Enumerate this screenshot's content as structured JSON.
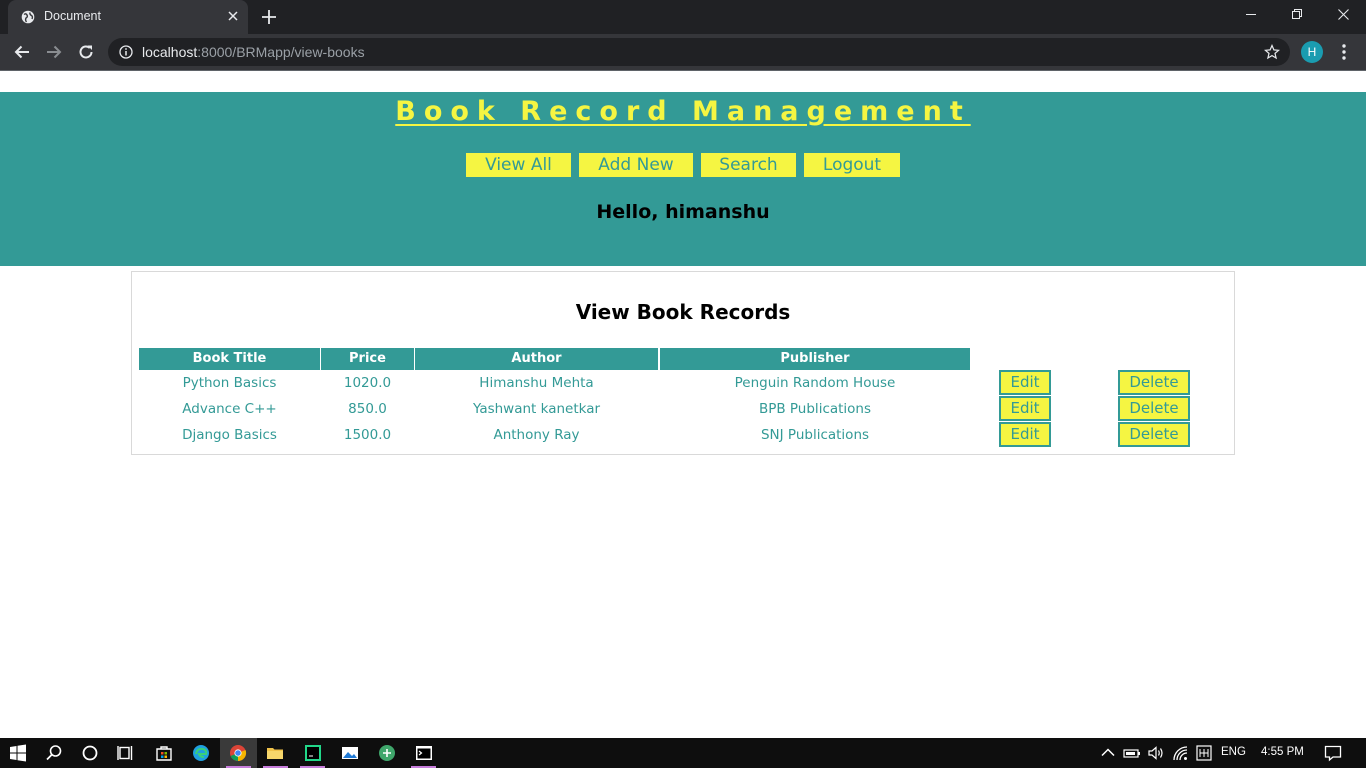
{
  "browser": {
    "tab_title": "Document",
    "url_host": "localhost",
    "url_rest": ":8000/BRMapp/view-books",
    "profile_initial": "H"
  },
  "header": {
    "site_title": "Book Record Management",
    "nav": [
      "View All",
      "Add New",
      "Search",
      "Logout"
    ],
    "greeting": "Hello, himanshu"
  },
  "records": {
    "title": "View Book Records",
    "columns": [
      "Book Title",
      "Price",
      "Author",
      "Publisher"
    ],
    "edit_label": "Edit",
    "delete_label": "Delete",
    "rows": [
      {
        "title": "Python Basics",
        "price": "1020.0",
        "author": "Himanshu Mehta",
        "publisher": "Penguin Random House"
      },
      {
        "title": "Advance C++",
        "price": "850.0",
        "author": "Yashwant kanetkar",
        "publisher": "BPB Publications"
      },
      {
        "title": "Django Basics",
        "price": "1500.0",
        "author": "Anthony Ray",
        "publisher": "SNJ Publications"
      }
    ]
  },
  "taskbar": {
    "language": "ENG",
    "time": "4:55 PM"
  },
  "colors": {
    "accent_teal": "#339a96",
    "accent_yellow": "#f5f542"
  }
}
